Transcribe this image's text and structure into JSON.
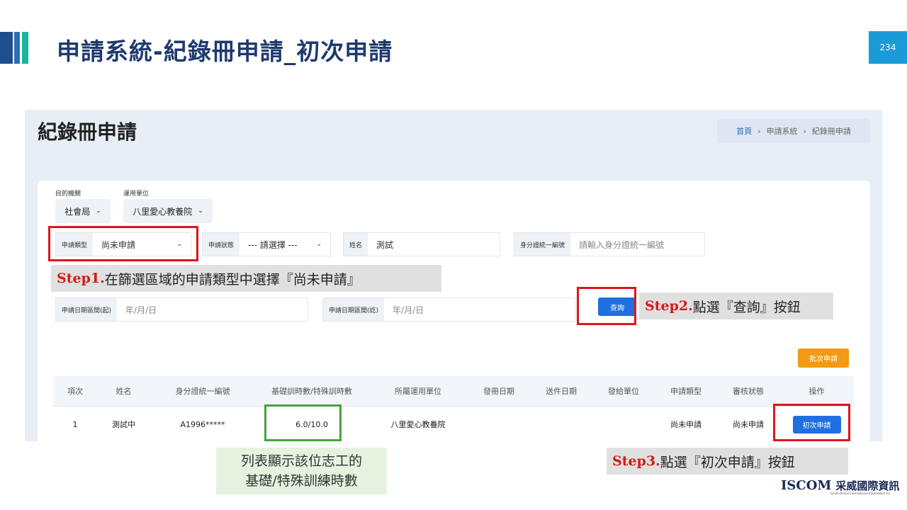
{
  "slide": {
    "title": "申請系統-紀錄冊申請_初次申請",
    "page_number": "234"
  },
  "screen": {
    "title": "紀錄冊申請",
    "breadcrumb": {
      "home": "首頁",
      "sep": "›",
      "level2": "申請系統",
      "level3": "紀錄冊申請"
    },
    "agency": {
      "label": "目的機關",
      "value": "社會局"
    },
    "unit": {
      "label": "運用單位",
      "value": "八里愛心教養院"
    },
    "filters": {
      "apply_type": {
        "label": "申請類型",
        "value": "尚未申請"
      },
      "apply_status": {
        "label": "申請狀態",
        "value": "--- 請選擇 ---"
      },
      "name": {
        "label": "姓名",
        "value": "測試"
      },
      "id_number": {
        "label": "身分證統一編號",
        "placeholder": "請輸入身分證統一編號"
      },
      "date_start": {
        "label": "申請日期區間(起)",
        "placeholder": "年/月/日"
      },
      "date_end": {
        "label": "申請日期區間(訖)",
        "placeholder": "年/月/日"
      }
    },
    "query_button": "查詢",
    "batch_button": "批次申請",
    "table": {
      "headers": [
        "項次",
        "姓名",
        "身分證統一編號",
        "基礎訓時數/特殊訓時數",
        "所屬運用單位",
        "發冊日期",
        "送件日期",
        "發給單位",
        "申請類型",
        "審核狀態",
        "操作"
      ],
      "rows": [
        {
          "index": "1",
          "name": "測試中",
          "id": "A1996*****",
          "hours": "6.0/10.0",
          "unit": "八里愛心教養院",
          "issue_date": "",
          "submit_date": "",
          "issuer": "",
          "type": "尚未申請",
          "status": "尚未申請",
          "action": "初次申請"
        }
      ]
    }
  },
  "annotations": {
    "step1_num": "Step1.",
    "step1_text": "在篩選區域的申請類型中選擇『尚未申請』",
    "step2_num": "Step2.",
    "step2_text": "點選『查詢』按鈕",
    "step3_num": "Step3.",
    "step3_text": "點選『初次申請』按鈕",
    "note_line1": "列表顯示該位志工的",
    "note_line2": "基礎/特殊訓練時數"
  },
  "logo": {
    "brand": "ISCOM",
    "cn": "采威國際資訊",
    "sub": "Iscom Online International Information Inc."
  },
  "colors": {
    "title": "#1e3a6e",
    "accent_blue": "#1f6fe0",
    "orange": "#f39a12",
    "red": "#e0141e",
    "green": "#4aa043",
    "page_badge": "#1a9ad6"
  }
}
